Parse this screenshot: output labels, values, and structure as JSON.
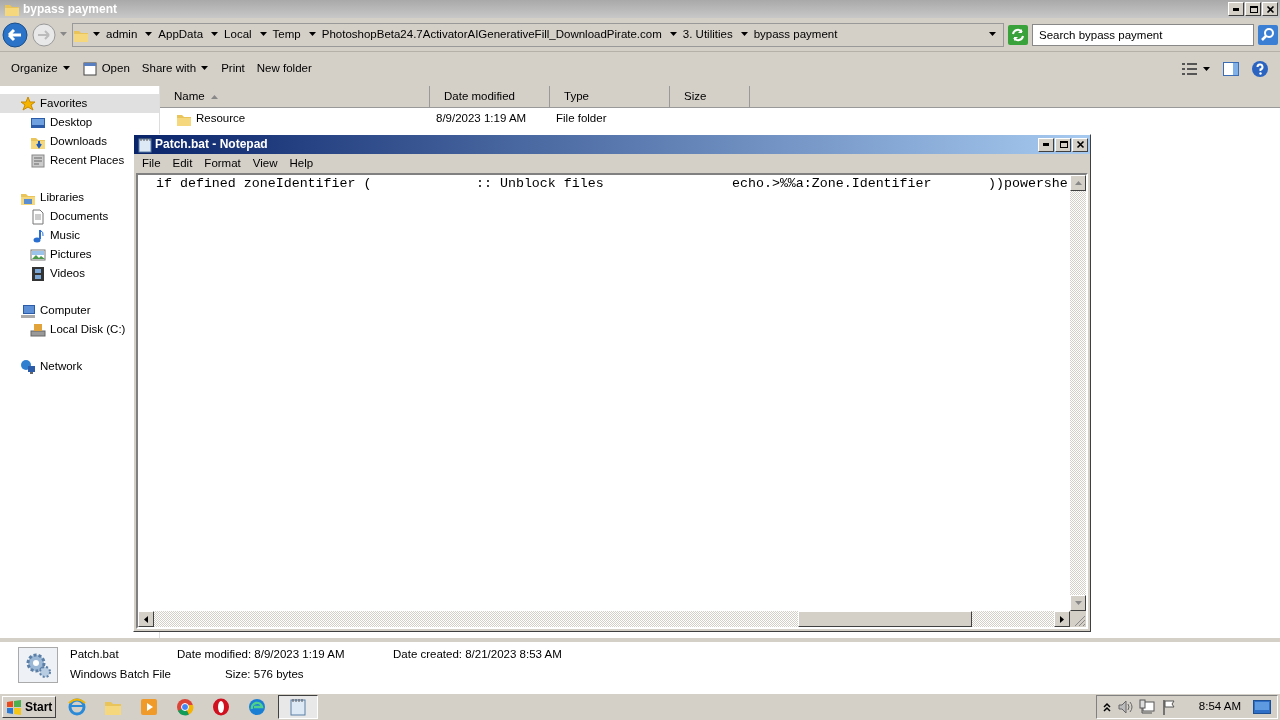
{
  "explorer": {
    "title": "bypass payment",
    "breadcrumbs": [
      "admin",
      "AppData",
      "Local",
      "Temp",
      "PhotoshopBeta24.7ActivatorAIGenerativeFill_DownloadPirate.com",
      "3. Utilities",
      "bypass payment"
    ],
    "search": {
      "placeholder": "Search bypass payment"
    },
    "toolbar": [
      {
        "label": "Organize",
        "kind": "menu"
      },
      {
        "label": "Open",
        "kind": "icon"
      },
      {
        "label": "Share with",
        "kind": "menu"
      },
      {
        "label": "Print",
        "kind": "plain"
      },
      {
        "label": "New folder",
        "kind": "plain"
      }
    ],
    "sidebar": [
      {
        "label": "Favorites",
        "kind": "star",
        "selected": true,
        "children": [
          {
            "label": "Desktop",
            "kind": "desktop",
            "selected": false
          },
          {
            "label": "Downloads",
            "kind": "downloads",
            "selected": false
          },
          {
            "label": "Recent Places",
            "kind": "recent",
            "selected": false
          }
        ]
      },
      {
        "label": "Libraries",
        "kind": "library",
        "selected": false,
        "children": [
          {
            "label": "Documents",
            "kind": "document",
            "selected": false
          },
          {
            "label": "Music",
            "kind": "music",
            "selected": false
          },
          {
            "label": "Pictures",
            "kind": "pictures",
            "selected": false
          },
          {
            "label": "Videos",
            "kind": "videos",
            "selected": false
          }
        ]
      },
      {
        "label": "Computer",
        "kind": "computer",
        "selected": false,
        "children": [
          {
            "label": "Local Disk (C:)",
            "kind": "disk",
            "selected": false
          }
        ]
      },
      {
        "label": "Network",
        "kind": "network",
        "selected": false
      }
    ],
    "columns": [
      "Name",
      "Date modified",
      "Type",
      "Size"
    ],
    "rows": [
      {
        "name": "Resource",
        "date": "8/9/2023 1:19 AM",
        "type": "File folder"
      }
    ],
    "details": {
      "name": "Patch.bat",
      "type": "Windows Batch File",
      "fields": [
        {
          "label": "Date modified:",
          "value": "8/9/2023 1:19 AM"
        },
        {
          "label": "Size:",
          "value": "576 bytes"
        },
        {
          "label": "Date created:",
          "value": "8/21/2023 8:53 AM"
        }
      ]
    }
  },
  "notepad": {
    "title": "Patch.bat - Notepad",
    "menu": [
      "File",
      "Edit",
      "Format",
      "View",
      "Help"
    ],
    "line": [
      "if defined zoneIdentifier (",
      ":: Unblock files",
      "echo.>%%a:Zone.Identifier",
      "))powershe"
    ]
  },
  "taskbar": {
    "start": "Start",
    "apps": [
      {
        "kind": "ie",
        "selected": false
      },
      {
        "kind": "folder",
        "selected": false
      },
      {
        "kind": "media",
        "selected": false
      },
      {
        "kind": "chrome",
        "selected": false
      },
      {
        "kind": "opera",
        "selected": false
      },
      {
        "kind": "edge",
        "selected": false
      },
      {
        "kind": "notepad",
        "selected": true
      }
    ],
    "clock": "8:54 AM"
  }
}
